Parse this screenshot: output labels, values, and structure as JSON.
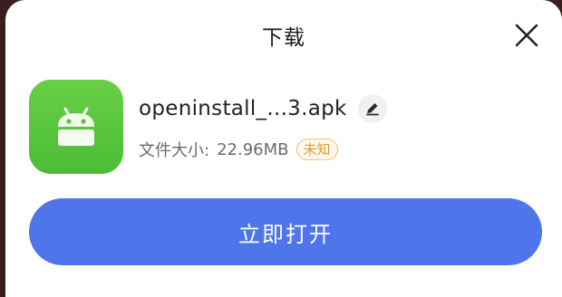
{
  "dialog": {
    "title": "下载",
    "close_icon": "close-icon"
  },
  "file": {
    "icon": "android-icon",
    "name": "openinstall_...3.apk",
    "edit_icon": "pencil-icon",
    "size_label": "文件大小:",
    "size_value": "22.96MB",
    "status": "未知"
  },
  "actions": {
    "open_label": "立即打开"
  },
  "colors": {
    "accent": "#4f75ea",
    "app_icon": "#5ac63d",
    "badge": "#e09a2a",
    "backdrop": "#3a1e1e"
  }
}
